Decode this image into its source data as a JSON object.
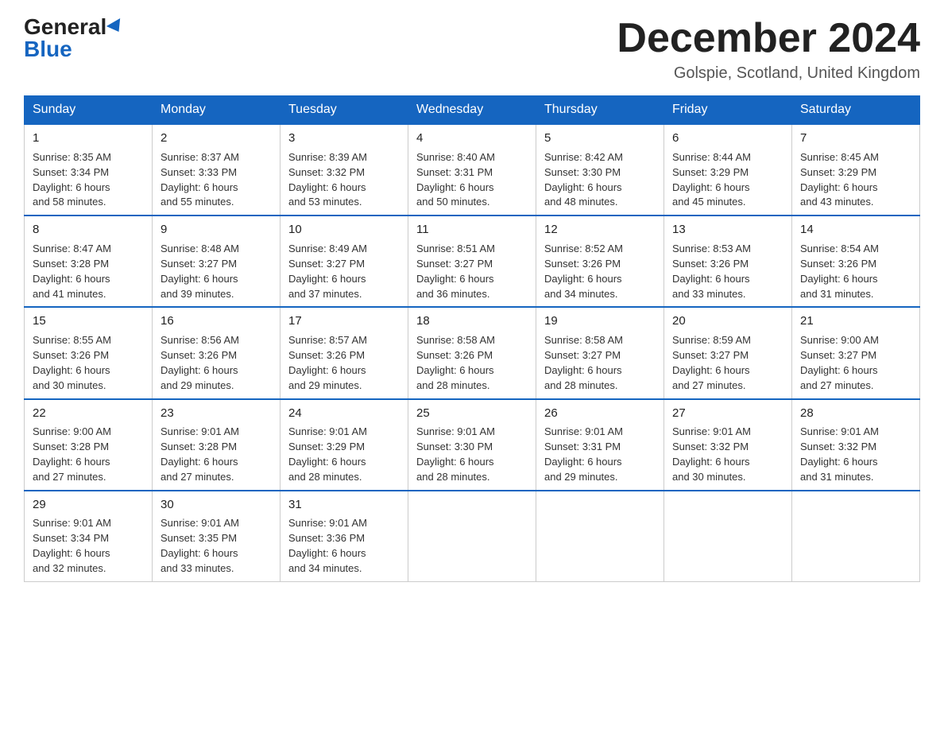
{
  "header": {
    "logo_general": "General",
    "logo_blue": "Blue",
    "title": "December 2024",
    "location": "Golspie, Scotland, United Kingdom"
  },
  "weekdays": [
    "Sunday",
    "Monday",
    "Tuesday",
    "Wednesday",
    "Thursday",
    "Friday",
    "Saturday"
  ],
  "weeks": [
    [
      {
        "day": "1",
        "sunrise": "8:35 AM",
        "sunset": "3:34 PM",
        "daylight": "6 hours and 58 minutes."
      },
      {
        "day": "2",
        "sunrise": "8:37 AM",
        "sunset": "3:33 PM",
        "daylight": "6 hours and 55 minutes."
      },
      {
        "day": "3",
        "sunrise": "8:39 AM",
        "sunset": "3:32 PM",
        "daylight": "6 hours and 53 minutes."
      },
      {
        "day": "4",
        "sunrise": "8:40 AM",
        "sunset": "3:31 PM",
        "daylight": "6 hours and 50 minutes."
      },
      {
        "day": "5",
        "sunrise": "8:42 AM",
        "sunset": "3:30 PM",
        "daylight": "6 hours and 48 minutes."
      },
      {
        "day": "6",
        "sunrise": "8:44 AM",
        "sunset": "3:29 PM",
        "daylight": "6 hours and 45 minutes."
      },
      {
        "day": "7",
        "sunrise": "8:45 AM",
        "sunset": "3:29 PM",
        "daylight": "6 hours and 43 minutes."
      }
    ],
    [
      {
        "day": "8",
        "sunrise": "8:47 AM",
        "sunset": "3:28 PM",
        "daylight": "6 hours and 41 minutes."
      },
      {
        "day": "9",
        "sunrise": "8:48 AM",
        "sunset": "3:27 PM",
        "daylight": "6 hours and 39 minutes."
      },
      {
        "day": "10",
        "sunrise": "8:49 AM",
        "sunset": "3:27 PM",
        "daylight": "6 hours and 37 minutes."
      },
      {
        "day": "11",
        "sunrise": "8:51 AM",
        "sunset": "3:27 PM",
        "daylight": "6 hours and 36 minutes."
      },
      {
        "day": "12",
        "sunrise": "8:52 AM",
        "sunset": "3:26 PM",
        "daylight": "6 hours and 34 minutes."
      },
      {
        "day": "13",
        "sunrise": "8:53 AM",
        "sunset": "3:26 PM",
        "daylight": "6 hours and 33 minutes."
      },
      {
        "day": "14",
        "sunrise": "8:54 AM",
        "sunset": "3:26 PM",
        "daylight": "6 hours and 31 minutes."
      }
    ],
    [
      {
        "day": "15",
        "sunrise": "8:55 AM",
        "sunset": "3:26 PM",
        "daylight": "6 hours and 30 minutes."
      },
      {
        "day": "16",
        "sunrise": "8:56 AM",
        "sunset": "3:26 PM",
        "daylight": "6 hours and 29 minutes."
      },
      {
        "day": "17",
        "sunrise": "8:57 AM",
        "sunset": "3:26 PM",
        "daylight": "6 hours and 29 minutes."
      },
      {
        "day": "18",
        "sunrise": "8:58 AM",
        "sunset": "3:26 PM",
        "daylight": "6 hours and 28 minutes."
      },
      {
        "day": "19",
        "sunrise": "8:58 AM",
        "sunset": "3:27 PM",
        "daylight": "6 hours and 28 minutes."
      },
      {
        "day": "20",
        "sunrise": "8:59 AM",
        "sunset": "3:27 PM",
        "daylight": "6 hours and 27 minutes."
      },
      {
        "day": "21",
        "sunrise": "9:00 AM",
        "sunset": "3:27 PM",
        "daylight": "6 hours and 27 minutes."
      }
    ],
    [
      {
        "day": "22",
        "sunrise": "9:00 AM",
        "sunset": "3:28 PM",
        "daylight": "6 hours and 27 minutes."
      },
      {
        "day": "23",
        "sunrise": "9:01 AM",
        "sunset": "3:28 PM",
        "daylight": "6 hours and 27 minutes."
      },
      {
        "day": "24",
        "sunrise": "9:01 AM",
        "sunset": "3:29 PM",
        "daylight": "6 hours and 28 minutes."
      },
      {
        "day": "25",
        "sunrise": "9:01 AM",
        "sunset": "3:30 PM",
        "daylight": "6 hours and 28 minutes."
      },
      {
        "day": "26",
        "sunrise": "9:01 AM",
        "sunset": "3:31 PM",
        "daylight": "6 hours and 29 minutes."
      },
      {
        "day": "27",
        "sunrise": "9:01 AM",
        "sunset": "3:32 PM",
        "daylight": "6 hours and 30 minutes."
      },
      {
        "day": "28",
        "sunrise": "9:01 AM",
        "sunset": "3:32 PM",
        "daylight": "6 hours and 31 minutes."
      }
    ],
    [
      {
        "day": "29",
        "sunrise": "9:01 AM",
        "sunset": "3:34 PM",
        "daylight": "6 hours and 32 minutes."
      },
      {
        "day": "30",
        "sunrise": "9:01 AM",
        "sunset": "3:35 PM",
        "daylight": "6 hours and 33 minutes."
      },
      {
        "day": "31",
        "sunrise": "9:01 AM",
        "sunset": "3:36 PM",
        "daylight": "6 hours and 34 minutes."
      },
      null,
      null,
      null,
      null
    ]
  ],
  "labels": {
    "sunrise": "Sunrise:",
    "sunset": "Sunset:",
    "daylight": "Daylight:"
  }
}
